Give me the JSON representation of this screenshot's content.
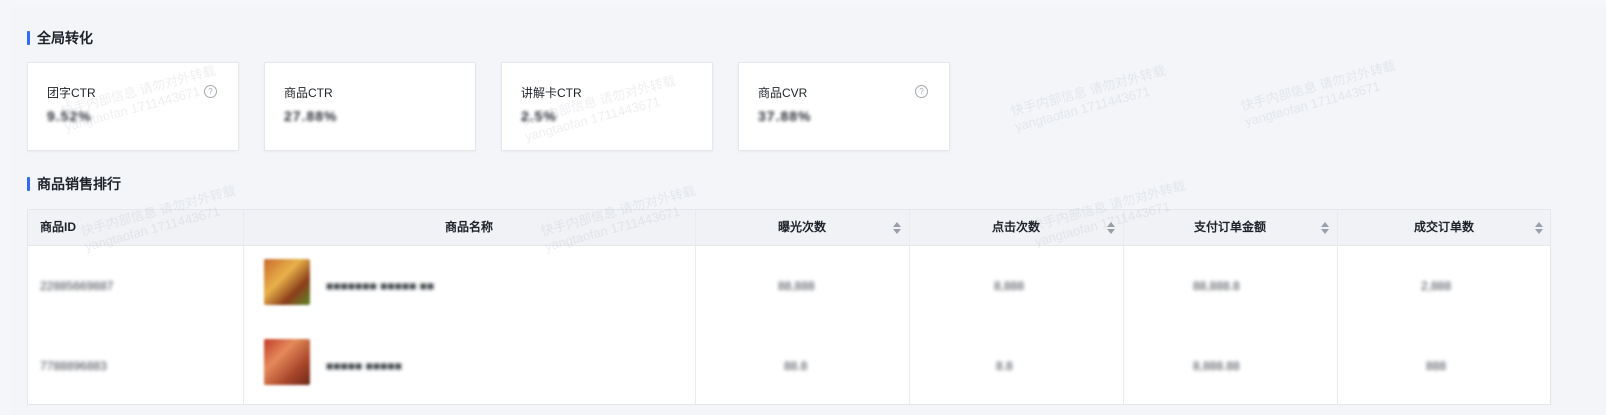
{
  "sections": {
    "global_conversion": "全局转化",
    "sales_ranking": "商品销售排行"
  },
  "metrics": [
    {
      "label": "团字CTR",
      "value": "9.52%",
      "has_help": true
    },
    {
      "label": "商品CTR",
      "value": "27.88%",
      "has_help": false
    },
    {
      "label": "讲解卡CTR",
      "value": "2.5%",
      "has_help": false
    },
    {
      "label": "商品CVR",
      "value": "37.88%",
      "has_help": true
    }
  ],
  "table": {
    "columns": [
      "商品ID",
      "商品名称",
      "曝光次数",
      "点击次数",
      "支付订单金额",
      "成交订单数"
    ],
    "rows": [
      {
        "id": "22885669887",
        "name": "■■■■■■■ ■■■■■ ■■",
        "exposure": "88,888",
        "clicks": "8,888",
        "amount": "88,888.8",
        "orders": "2,888"
      },
      {
        "id": "7788896883",
        "name": "■■■■■ ■■■■■",
        "exposure": "88.8",
        "clicks": "8.8",
        "amount": "8,888.88",
        "orders": "888"
      }
    ]
  },
  "watermark": {
    "line1": "快手内部信息 请勿对外转载",
    "line2": "yangtaofan 1711443671"
  },
  "colors": {
    "accent": "#2f6bff",
    "background": "#f4f6f9"
  },
  "icons": {
    "help": "question-circle-icon",
    "sort": "sort-caret-icon"
  }
}
